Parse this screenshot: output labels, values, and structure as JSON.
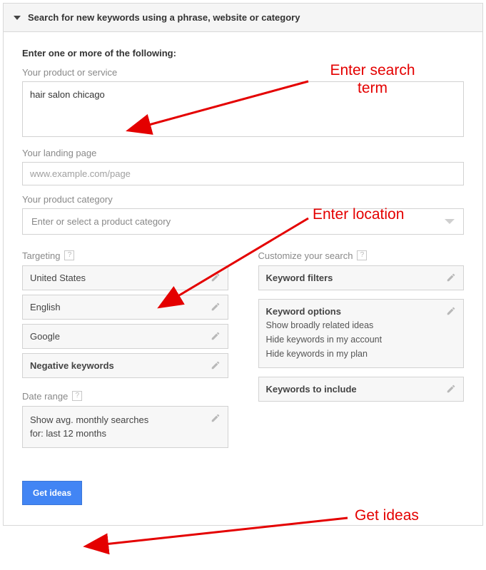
{
  "header": {
    "title": "Search for new keywords using a phrase, website or category"
  },
  "intro": "Enter one or more of the following:",
  "fields": {
    "product_label": "Your product or service",
    "product_value": "hair salon chicago",
    "landing_label": "Your landing page",
    "landing_placeholder": "www.example.com/page",
    "category_label": "Your product category",
    "category_placeholder": "Enter or select a product category"
  },
  "targeting": {
    "label": "Targeting",
    "location": "United States",
    "language": "English",
    "network": "Google",
    "negative": "Negative keywords"
  },
  "daterange": {
    "label": "Date range",
    "value_line1": "Show avg. monthly searches",
    "value_line2": "for: last 12 months"
  },
  "customize": {
    "label": "Customize your search",
    "filters": "Keyword filters",
    "options_title": "Keyword options",
    "options_lines": [
      "Show broadly related ideas",
      "Hide keywords in my account",
      "Hide keywords in my plan"
    ],
    "include": "Keywords to include"
  },
  "button": "Get ideas",
  "annotations": {
    "a1_line1": "Enter search",
    "a1_line2": "term",
    "a2": "Enter location",
    "a3": "Get ideas"
  }
}
